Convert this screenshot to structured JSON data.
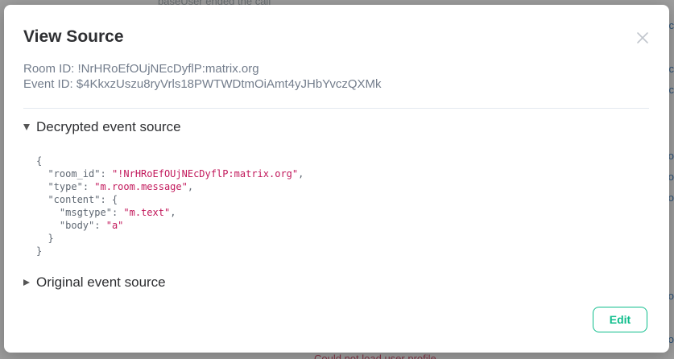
{
  "background": {
    "timeline_snippet": "baseUser ended the call",
    "bottom_snippet": "Could not load user profile"
  },
  "dialog": {
    "title": "View Source",
    "room_id_line": "Room ID: !NrHRoEfOUjNEcDyflP:matrix.org",
    "event_id_line": "Event ID: $4KkxzUszu8ryVrls18PWTWDtmOiAmt4yJHbYvczQXMk",
    "decrypted_section": {
      "label": "Decrypted event source",
      "expanded": true
    },
    "original_section": {
      "label": "Original event source",
      "expanded": false
    },
    "source_json": {
      "room_id_key": "\"room_id\"",
      "room_id_value": "\"!NrHRoEfOUjNEcDyflP:matrix.org\"",
      "type_key": "\"type\"",
      "type_value": "\"m.room.message\"",
      "content_key": "\"content\"",
      "msgtype_key": "\"msgtype\"",
      "msgtype_value": "\"m.text\"",
      "body_key": "\"body\"",
      "body_value": "\"a\""
    },
    "edit_label": "Edit",
    "close_icon": "close-icon"
  },
  "colors": {
    "accent": "#0dbd8b",
    "json_string": "#c2185b",
    "secondary_text": "#737d8c"
  }
}
